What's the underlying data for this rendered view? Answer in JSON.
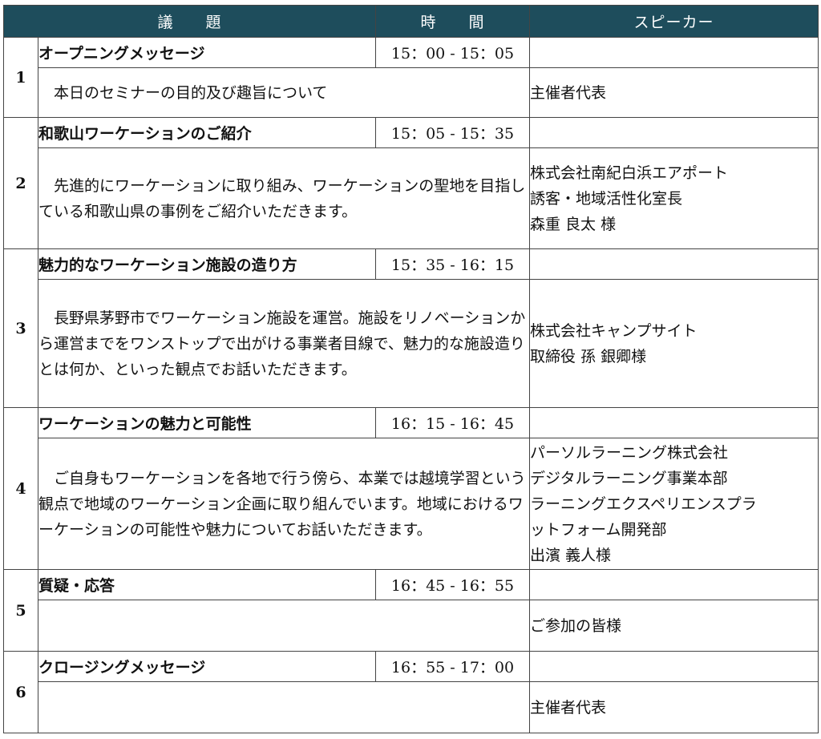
{
  "header": {
    "col_topic": "議　　題",
    "col_time": "時　　間",
    "col_speaker": "スピーカー"
  },
  "sessions": [
    {
      "number": "1",
      "title": "オープニングメッセージ",
      "time": "15：00 - 15：05",
      "description": "本日のセミナーの目的及び趣旨について",
      "speaker_lines": [
        "主催者代表"
      ]
    },
    {
      "number": "2",
      "title": "和歌山ワーケーションのご紹介",
      "time": "15：05 - 15：35",
      "description": "先進的にワーケーションに取り組み、ワーケーションの聖地を目指している和歌山県の事例をご紹介いただきます。",
      "speaker_lines": [
        "株式会社南紀白浜エアポート",
        "誘客・地域活性化室長",
        "森重 良太 様"
      ]
    },
    {
      "number": "3",
      "title": "魅力的なワーケーション施設の造り方",
      "time": "15：35 - 16：15",
      "description": "長野県茅野市でワーケーション施設を運営。施設をリノベーションから運営までをワンストップで出がける事業者目線で、魅力的な施設造りとは何か、といった観点でお話いただきます。",
      "speaker_lines": [
        "株式会社キャンプサイト",
        "取締役 孫 銀卿様"
      ]
    },
    {
      "number": "4",
      "title": "ワーケーションの魅力と可能性",
      "time": "16：15 - 16：45",
      "description": "ご自身もワーケーションを各地で行う傍ら、本業では越境学習という観点で地域のワーケーション企画に取り組んでいます。地域におけるワーケーションの可能性や魅力についてお話いただきます。",
      "speaker_lines": [
        "パーソルラーニング株式会社",
        "デジタルラーニング事業本部",
        "ラーニングエクスペリエンスプラ",
        "ットフォーム開発部",
        "出濱 義人様"
      ]
    },
    {
      "number": "5",
      "title": "質疑・応答",
      "time": "16：45 - 16：55",
      "description": "",
      "speaker_lines": [
        "ご参加の皆様"
      ]
    },
    {
      "number": "6",
      "title": "クロージングメッセージ",
      "time": "16：55 - 17：00",
      "description": "",
      "speaker_lines": [
        "主催者代表"
      ]
    }
  ]
}
